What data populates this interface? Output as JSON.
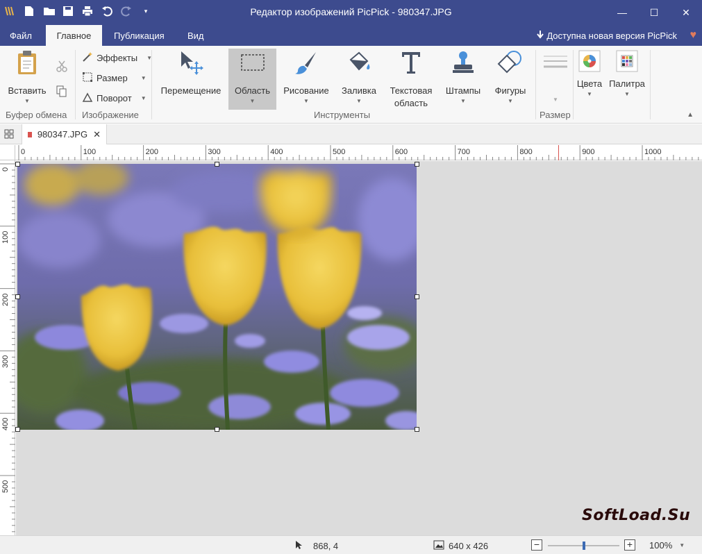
{
  "app": {
    "title": "Редактор изображений PicPick - 980347.JPG",
    "update_notice": "Доступна новая версия PicPick"
  },
  "menu": {
    "tabs": [
      {
        "label": "Файл"
      },
      {
        "label": "Главное"
      },
      {
        "label": "Публикация"
      },
      {
        "label": "Вид"
      }
    ]
  },
  "ribbon": {
    "clipboard": {
      "paste": "Вставить",
      "group": "Буфер обмена"
    },
    "image": {
      "effects": "Эффекты",
      "resize": "Размер",
      "rotate": "Поворот",
      "group": "Изображение"
    },
    "tools": {
      "move": "Перемещение",
      "area": "Область",
      "draw": "Рисование",
      "fill": "Заливка",
      "text_line1": "Текстовая",
      "text_line2": "область",
      "stamps": "Штампы",
      "shapes": "Фигуры",
      "group": "Инструменты"
    },
    "size": {
      "group": "Размер"
    },
    "colors": "Цвета",
    "palette": "Палитра"
  },
  "document": {
    "tab_name": "980347.JPG"
  },
  "rulers": {
    "h_labels": [
      "0",
      "100",
      "200",
      "300",
      "400",
      "500",
      "600",
      "700",
      "800",
      "900",
      "1000"
    ],
    "v_labels": [
      "0",
      "100",
      "200",
      "300",
      "400",
      "500"
    ]
  },
  "watermark": "SoftLoad.Su",
  "status": {
    "cursor": "868, 4",
    "image_size": "640 x 426",
    "zoom": "100%",
    "zoom_level": 0.5
  },
  "colors": {
    "titlebar": "#3d4b8e",
    "ribbon": "#f7f7f7",
    "canvas": "#dcdcdc"
  }
}
